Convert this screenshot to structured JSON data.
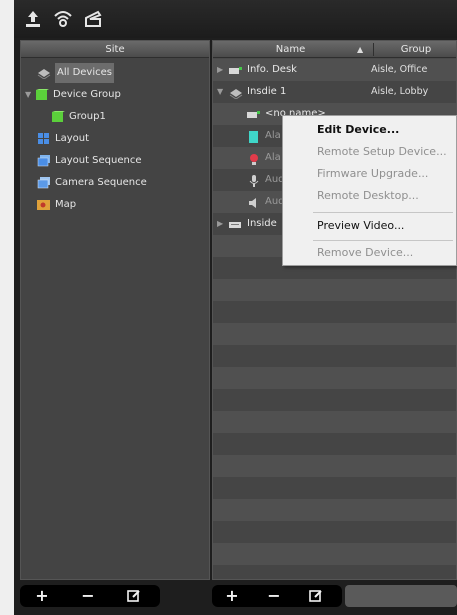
{
  "toolbar": {
    "icons": [
      "upload-icon",
      "wireless-icon",
      "eject-icon"
    ]
  },
  "site_panel": {
    "header": "Site",
    "items": [
      {
        "label": "All Devices",
        "icon": "devices-icon",
        "selected": true
      },
      {
        "label": "Device Group",
        "icon": "cube-icon",
        "expanded": true
      },
      {
        "label": "Group1",
        "icon": "cube-icon"
      },
      {
        "label": "Layout",
        "icon": "layout-icon"
      },
      {
        "label": "Layout Sequence",
        "icon": "layout-sequence-icon"
      },
      {
        "label": "Camera Sequence",
        "icon": "camera-sequence-icon"
      },
      {
        "label": "Map",
        "icon": "map-icon"
      }
    ],
    "bottom_buttons": [
      "+",
      "−",
      "edit-icon"
    ]
  },
  "device_panel": {
    "columns": {
      "name": "Name",
      "group": "Group"
    },
    "sort": "ascending",
    "rows": [
      {
        "name": "Info. Desk",
        "group": "Aisle, Office",
        "level": 0,
        "collapsed": true,
        "icon": "device-icon"
      },
      {
        "name": "Insdie 1",
        "group": "Aisle, Lobby",
        "level": 0,
        "expanded": true,
        "icon": "devices-icon"
      },
      {
        "name": "<no name>",
        "group": "",
        "level": 1,
        "icon": "device-icon"
      },
      {
        "name": "Ala",
        "group": "",
        "level": 1,
        "icon": "alarm-in-icon"
      },
      {
        "name": "Ala",
        "group": "",
        "level": 1,
        "icon": "alarm-out-icon"
      },
      {
        "name": "Aud",
        "group": "",
        "level": 1,
        "icon": "microphone-icon"
      },
      {
        "name": "Aud",
        "group": "",
        "level": 1,
        "icon": "speaker-icon"
      },
      {
        "name": "Inside",
        "group": "",
        "level": 0,
        "collapsed": true,
        "icon": "device-icon"
      }
    ],
    "bottom_buttons": [
      "+",
      "−",
      "edit-icon"
    ]
  },
  "context_menu": {
    "items": [
      {
        "label": "Edit Device...",
        "enabled": true,
        "bold": true
      },
      {
        "label": "Remote Setup Device...",
        "enabled": false
      },
      {
        "label": "Firmware Upgrade...",
        "enabled": false
      },
      {
        "label": "Remote Desktop...",
        "enabled": false
      },
      {
        "label": "Preview Video...",
        "enabled": true
      },
      {
        "label": "Remove Device...",
        "enabled": false
      }
    ]
  },
  "colors": {
    "background": "#1e1e1e",
    "panel": "#444444",
    "row_alt": "#505050",
    "menu_bg": "#f0f0f0",
    "menu_disabled": "#8f8f8f"
  }
}
